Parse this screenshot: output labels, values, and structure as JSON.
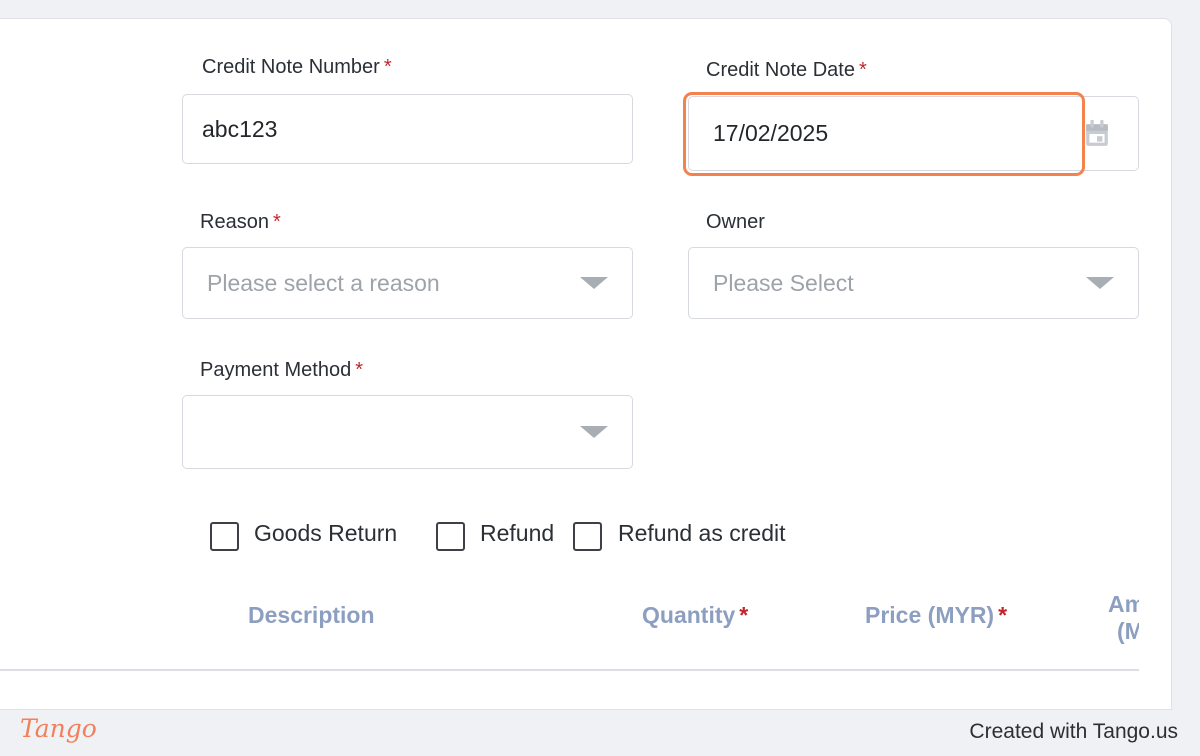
{
  "form": {
    "credit_note_number": {
      "label": "Credit Note Number",
      "value": "abc123"
    },
    "credit_note_date": {
      "label": "Credit Note Date",
      "value": "17/02/2025"
    },
    "reason": {
      "label": "Reason",
      "placeholder": "Please select a reason"
    },
    "owner": {
      "label": "Owner",
      "placeholder": "Please Select"
    },
    "payment_method": {
      "label": "Payment Method",
      "value": ""
    },
    "required_marker": "*"
  },
  "checkboxes": [
    {
      "label": "Goods Return",
      "checked": false
    },
    {
      "label": "Refund",
      "checked": false
    },
    {
      "label": "Refund as credit",
      "checked": false
    }
  ],
  "table": {
    "headers": [
      {
        "label": "Description",
        "required": false
      },
      {
        "label": "Quantity",
        "required": true
      },
      {
        "label": "Price (MYR)",
        "required": true
      },
      {
        "label": "Am",
        "line2": "(M",
        "required": false
      }
    ]
  },
  "footer": {
    "logo": "Tango",
    "credit": "Created with Tango.us"
  },
  "colors": {
    "highlight": "#f4824f",
    "required": "#c0262d",
    "table_header": "#8d9fc0"
  }
}
